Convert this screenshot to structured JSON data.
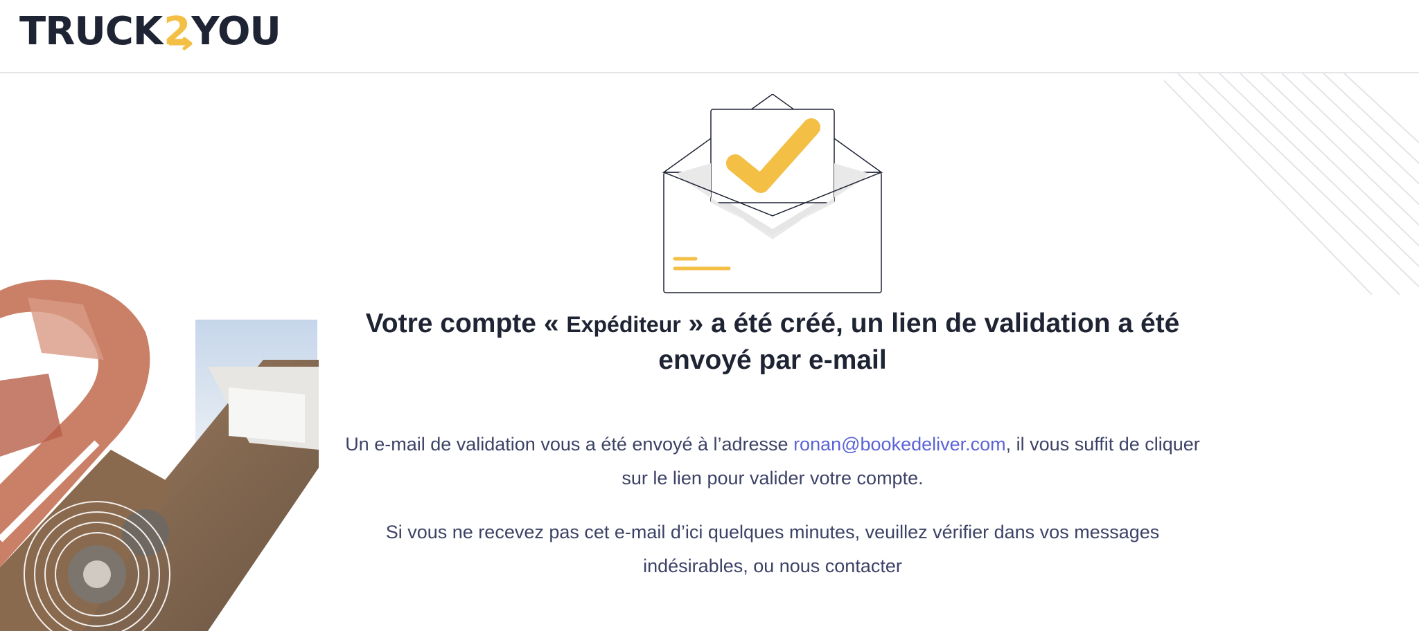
{
  "header": {
    "logo_part1": "TRUCK",
    "logo_part2": "2",
    "logo_part3": "YOU"
  },
  "confirmation": {
    "title_part1": "Votre compte « ",
    "role": "Expéditeur",
    "title_part2": " » a été créé, un lien de validation a été envoyé par e-mail",
    "line1_pre": "Un e-mail de validation vous a été envoyé à l’adresse ",
    "email": "ronan@bookedeliver.com",
    "line1_post": ", il vous suffit de cliquer sur le lien pour valider votre compte.",
    "line2": "Si vous ne recevez pas cet e-mail d’ici quelques minutes, veuillez vérifier dans vos messages indésirables, ou nous contacter"
  },
  "colors": {
    "brand_dark": "#1f2434",
    "accent_yellow": "#f3bf45",
    "link": "#5a63d8",
    "text": "#3c4266"
  },
  "icons": [
    "envelope-check-icon"
  ]
}
